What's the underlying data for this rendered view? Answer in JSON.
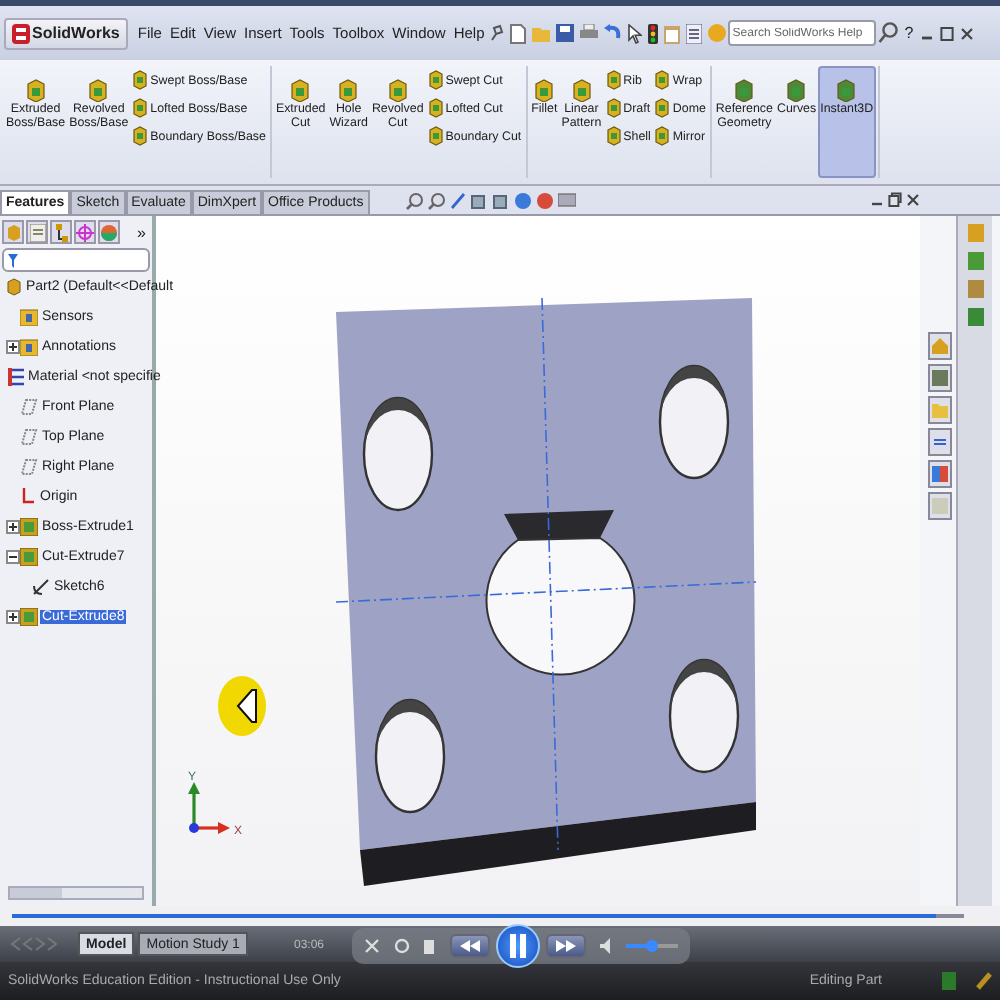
{
  "window": {
    "logo_text": "SolidWorks",
    "help": "?"
  },
  "menu": [
    "File",
    "Edit",
    "View",
    "Insert",
    "Tools",
    "Toolbox",
    "Window",
    "Help"
  ],
  "search": {
    "placeholder": "Search SolidWorks Help"
  },
  "ribbon_groups": [
    {
      "columns": [
        {
          "kind": "large",
          "label": "Extruded Boss/Base",
          "selected": false
        },
        {
          "kind": "large",
          "label": "Revolved Boss/Base",
          "selected": false
        },
        {
          "kind": "stack",
          "items": [
            "Swept Boss/Base",
            "Lofted Boss/Base",
            "Boundary Boss/Base"
          ]
        }
      ]
    },
    {
      "columns": [
        {
          "kind": "large",
          "label": "Extruded Cut",
          "selected": false
        },
        {
          "kind": "large",
          "label": "Hole Wizard",
          "selected": false
        },
        {
          "kind": "large",
          "label": "Revolved Cut",
          "selected": false
        },
        {
          "kind": "stack",
          "items": [
            "Swept Cut",
            "Lofted Cut",
            "Boundary Cut"
          ]
        }
      ]
    },
    {
      "columns": [
        {
          "kind": "large",
          "label": "Fillet",
          "selected": false
        },
        {
          "kind": "large",
          "label": "Linear Pattern",
          "selected": false
        },
        {
          "kind": "stack",
          "items": [
            "Rib",
            "Draft",
            "Shell"
          ]
        },
        {
          "kind": "stack",
          "items": [
            "Wrap",
            "Dome",
            "Mirror"
          ]
        }
      ]
    },
    {
      "columns": [
        {
          "kind": "large",
          "label": "Reference Geometry",
          "selected": false
        },
        {
          "kind": "large",
          "label": "Curves",
          "selected": false
        },
        {
          "kind": "large",
          "label": "Instant3D",
          "selected": true
        }
      ]
    }
  ],
  "command_tabs": [
    {
      "label": "Features",
      "selected": true
    },
    {
      "label": "Sketch",
      "selected": false
    },
    {
      "label": "Evaluate",
      "selected": false
    },
    {
      "label": "DimXpert",
      "selected": false
    },
    {
      "label": "Office Products",
      "selected": false
    }
  ],
  "tree": {
    "more": "»",
    "root": {
      "label": "Part2  (Default<<Default",
      "kind": "part"
    },
    "items": [
      {
        "label": "Sensors",
        "kind": "folder",
        "selected": false
      },
      {
        "label": "Annotations",
        "kind": "folder",
        "expanded": false,
        "selected": false
      },
      {
        "label": "Material <not specifie",
        "kind": "material",
        "selected": false
      },
      {
        "label": "Front Plane",
        "kind": "plane",
        "selected": false
      },
      {
        "label": "Top Plane",
        "kind": "plane",
        "selected": false
      },
      {
        "label": "Right Plane",
        "kind": "plane",
        "selected": false
      },
      {
        "label": "Origin",
        "kind": "origin",
        "selected": false
      },
      {
        "label": "Boss-Extrude1",
        "kind": "feature",
        "expanded": false,
        "selected": false
      },
      {
        "label": "Cut-Extrude7",
        "kind": "feature",
        "expanded": true,
        "selected": false,
        "children": [
          {
            "label": "Sketch6",
            "kind": "sketch",
            "selected": false
          }
        ]
      },
      {
        "label": "Cut-Extrude8",
        "kind": "feature",
        "expanded": false,
        "selected": true
      }
    ]
  },
  "viewport": {
    "triad": {
      "x_label": "X",
      "y_label": "Y"
    }
  },
  "bottom_tabs": [
    {
      "label": "Model",
      "selected": true
    },
    {
      "label": "Motion Study 1",
      "selected": false
    }
  ],
  "player": {
    "time": "03:06",
    "playing": true,
    "seek": {
      "level": 0.97
    },
    "volume": {
      "level": 0.5
    }
  },
  "status_bar": {
    "message": "SolidWorks Education Edition - Instructional Use Only",
    "mode": "Editing Part"
  }
}
